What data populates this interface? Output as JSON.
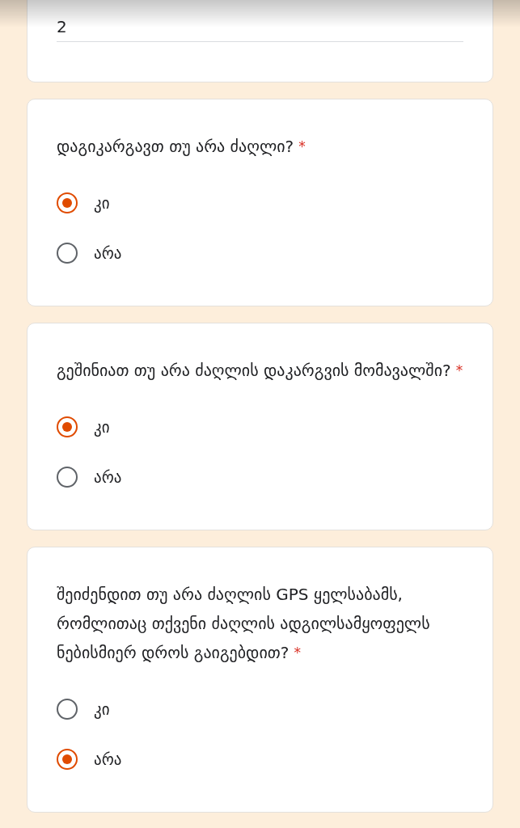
{
  "answer_field": {
    "value": "2"
  },
  "questions": [
    {
      "text": "დაგიკარგავთ თუ არა ძაღლი?",
      "required_mark": "*",
      "options": [
        {
          "label": "კი",
          "selected": true
        },
        {
          "label": "არა",
          "selected": false
        }
      ]
    },
    {
      "text": "გეშინიათ თუ არა ძაღლის დაკარგვის მომავალში?",
      "required_mark": "*",
      "options": [
        {
          "label": "კი",
          "selected": true
        },
        {
          "label": "არა",
          "selected": false
        }
      ]
    },
    {
      "text": "შეიძენდით თუ არა ძაღლის GPS ყელსაბამს, რომლითაც თქვენი ძაღლის ადგილსამყოფელს ნებისმიერ დროს გაიგებდით?",
      "required_mark": "*",
      "options": [
        {
          "label": "კი",
          "selected": false
        },
        {
          "label": "არა",
          "selected": true
        }
      ]
    }
  ]
}
